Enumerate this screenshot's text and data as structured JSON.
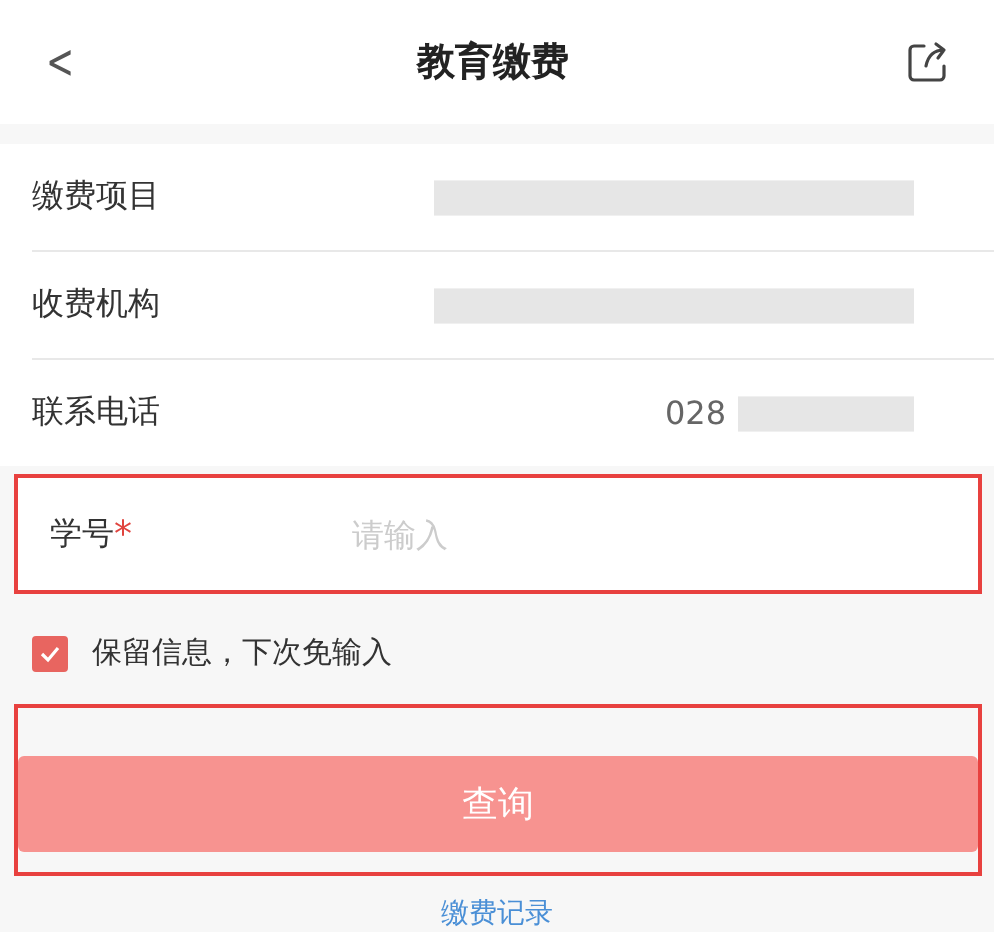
{
  "header": {
    "back": "<",
    "title": "教育缴费"
  },
  "info_rows": [
    {
      "label": "缴费项目",
      "redacted": true
    },
    {
      "label": "收费机构",
      "redacted": true
    },
    {
      "label": "联系电话",
      "value": "028",
      "redacted": true
    }
  ],
  "student_id": {
    "label": "学号",
    "required_mark": "*",
    "placeholder": "请输入",
    "highlighted": true
  },
  "remember": {
    "label": "保留信息，下次免输入",
    "checked": true
  },
  "query_button": {
    "label": "查询",
    "highlighted": true
  },
  "records_link": "缴费记录"
}
